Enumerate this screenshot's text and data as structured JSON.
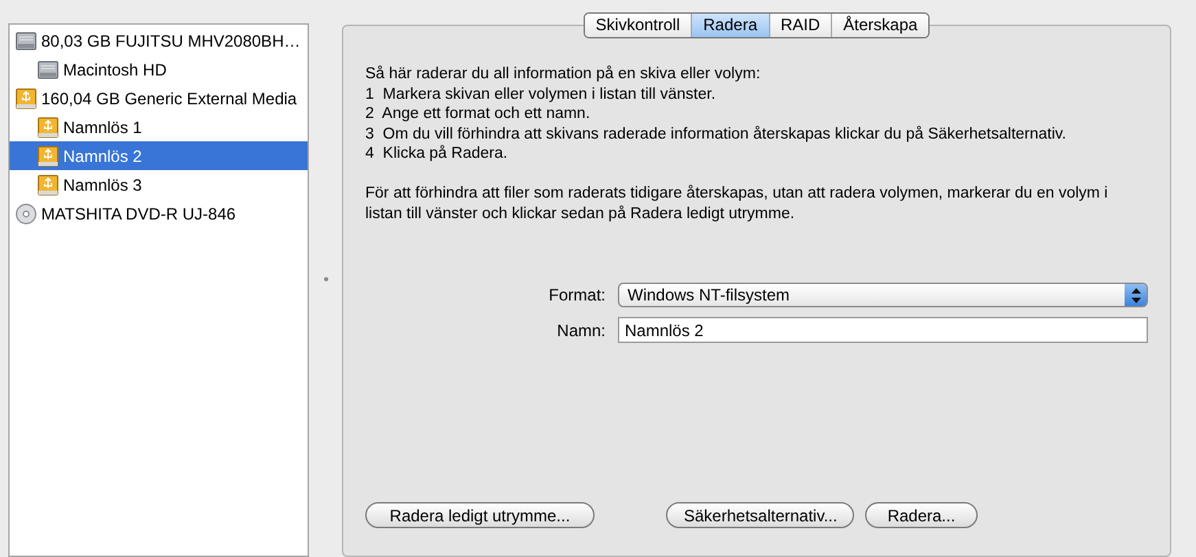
{
  "sidebar": {
    "items": [
      {
        "label": "80,03 GB FUJITSU MHV2080BH…",
        "kind": "hdd",
        "selected": false,
        "children": [
          {
            "label": "Macintosh HD",
            "kind": "hdd",
            "selected": false
          }
        ]
      },
      {
        "label": "160,04 GB Generic External Media",
        "kind": "usb",
        "selected": false,
        "children": [
          {
            "label": "Namnlös 1",
            "kind": "usb",
            "selected": false
          },
          {
            "label": "Namnlös 2",
            "kind": "usb",
            "selected": true
          },
          {
            "label": "Namnlös 3",
            "kind": "usb",
            "selected": false
          }
        ]
      },
      {
        "label": "MATSHITA DVD-R UJ-846",
        "kind": "optical",
        "selected": false
      }
    ]
  },
  "tabs": [
    {
      "label": "Skivkontroll",
      "selected": false
    },
    {
      "label": "Radera",
      "selected": true
    },
    {
      "label": "RAID",
      "selected": false
    },
    {
      "label": "Återskapa",
      "selected": false
    }
  ],
  "instructions": [
    "Så här raderar du all information på en skiva eller volym:",
    "1  Markera skivan eller volymen i listan till vänster.",
    "2  Ange ett format och ett namn.",
    "3  Om du vill förhindra att skivans raderade information återskapas klickar du på Säkerhetsalternativ.",
    "4  Klicka på Radera."
  ],
  "note": "För att förhindra att filer som raderats tidigare återskapas, utan att radera volymen, markerar du en volym i listan till vänster och klickar sedan på Radera ledigt utrymme.",
  "format": {
    "label": "Format:",
    "value": "Windows NT-filsystem"
  },
  "name": {
    "label": "Namn:",
    "value": "Namnlös 2"
  },
  "buttons": {
    "erase_free_space": "Radera ledigt utrymme...",
    "security_options": "Säkerhetsalternativ...",
    "erase": "Radera..."
  }
}
